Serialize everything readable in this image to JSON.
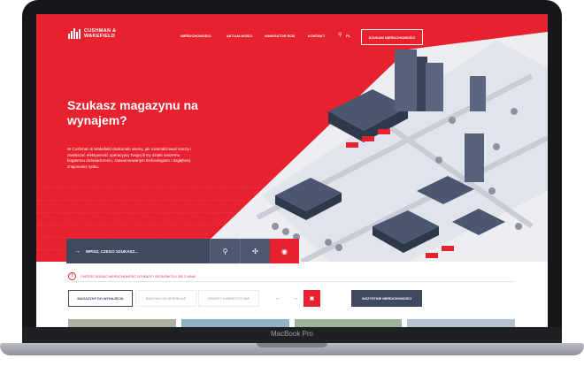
{
  "header": {
    "logo_line1": "CUSHMAN &",
    "logo_line2": "WAKEFIELD",
    "nav": [
      "NIERUCHOMOŚCI",
      "AKTUALNOŚCI",
      "NAWIGATOR SCB",
      "KONTAKT"
    ],
    "lang": "PL",
    "cta": "SZUKAM NIERUCHOMOŚCI"
  },
  "hero": {
    "title": "Szukasz magazynu na wynajem?",
    "description": "W Cushman & Wakefield doskonale wiemy, jak minimalizować koszty i zwiększać efektywność operacyjną Twojej firmy dzięki naszemu bogatemu doświadczeniu, zaawansowanym technologiom i dogłębnej znajomości rynku."
  },
  "search": {
    "placeholder": "WPISZ, CZEGO SZUKASZ..."
  },
  "notice": "CHCESZ DODAĆ NIERUCHOMOŚĆ DO BAZY? SKONTAKTUJ SIĘ Z NAMI",
  "tabs": [
    "MAGAZYNY DO WYNAJĘCIA",
    "BUDYNKI NA SPRZEDAŻ",
    "GRUNTY INWESTYCYJNE"
  ],
  "all_button": "WSZYSTKIE NIERUCHOMOŚCI",
  "device_label": "MacBook Pro",
  "colors": {
    "brand_red": "#e8212e",
    "navy": "#3e4a60"
  },
  "icons": [
    "search-icon",
    "share-icon",
    "target-icon",
    "arrow-left-icon",
    "arrow-right-icon",
    "info-icon"
  ]
}
